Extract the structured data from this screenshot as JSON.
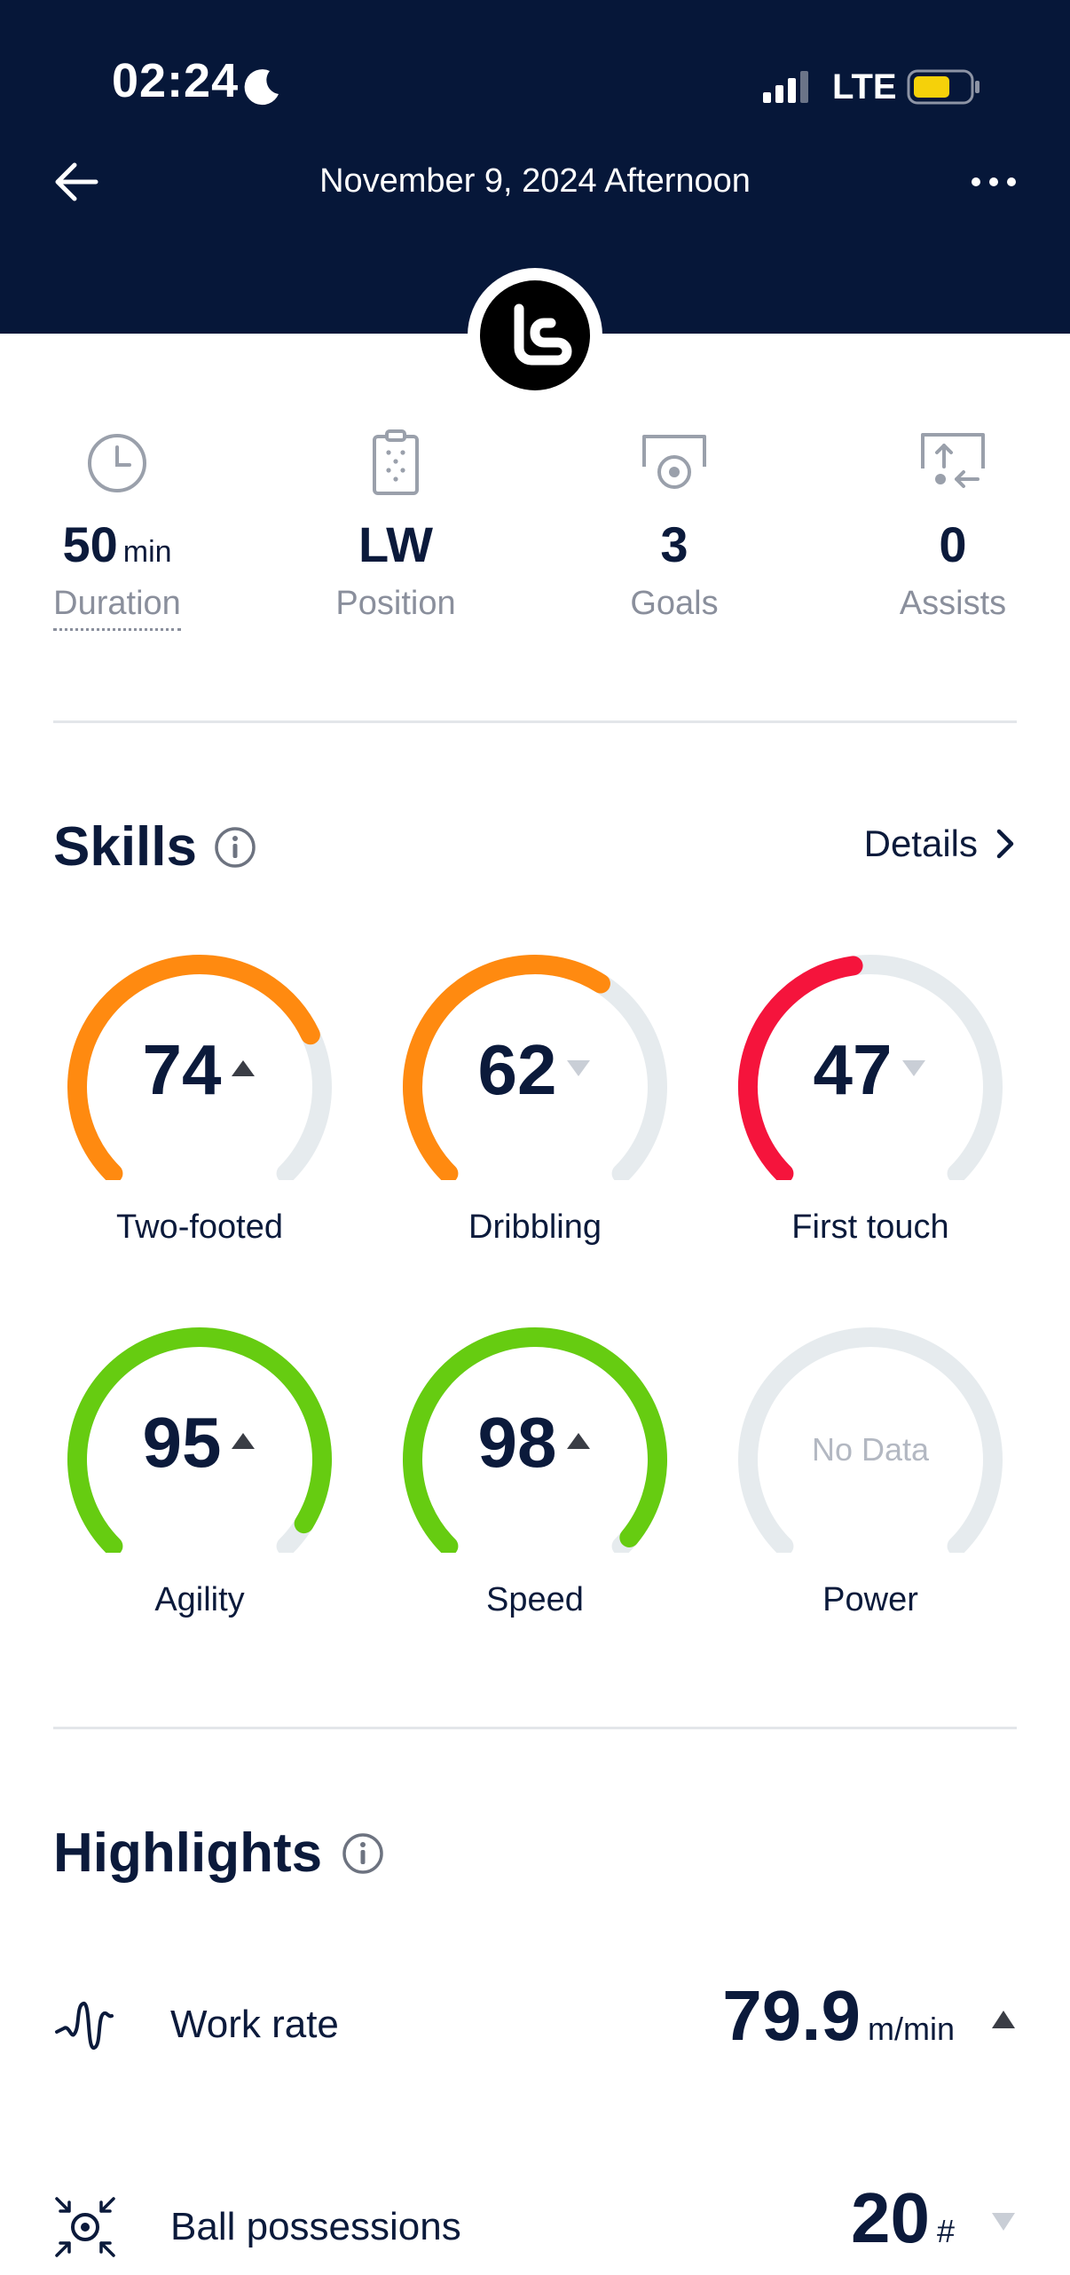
{
  "status_bar": {
    "time": "02:24",
    "network": "LTE"
  },
  "header": {
    "title": "November 9, 2024 Afternoon"
  },
  "stats": [
    {
      "value": "50",
      "unit": "min",
      "label": "Duration",
      "icon": "clock-icon"
    },
    {
      "value": "LW",
      "unit": "",
      "label": "Position",
      "icon": "clipboard-icon"
    },
    {
      "value": "3",
      "unit": "",
      "label": "Goals",
      "icon": "goal-icon"
    },
    {
      "value": "0",
      "unit": "",
      "label": "Assists",
      "icon": "assist-icon"
    }
  ],
  "skills": {
    "title": "Skills",
    "details_label": "Details",
    "items": [
      {
        "label": "Two-footed",
        "score": "74",
        "value": 74,
        "trend": "up",
        "color": "#ff8a10"
      },
      {
        "label": "Dribbling",
        "score": "62",
        "value": 62,
        "trend": "down",
        "color": "#ff8a10"
      },
      {
        "label": "First touch",
        "score": "47",
        "value": 47,
        "trend": "down",
        "color": "#f5143c"
      },
      {
        "label": "Agility",
        "score": "95",
        "value": 95,
        "trend": "up",
        "color": "#66cc11"
      },
      {
        "label": "Speed",
        "score": "98",
        "value": 98,
        "trend": "up",
        "color": "#66cc11"
      },
      {
        "label": "Power",
        "score": "No Data",
        "value": null,
        "trend": "none",
        "color": "#e6ebee"
      }
    ]
  },
  "highlights": {
    "title": "Highlights",
    "items": [
      {
        "label": "Work rate",
        "value": "79.9",
        "unit": "m/min",
        "trend": "up",
        "icon": "work-rate-icon"
      },
      {
        "label": "Ball possessions",
        "value": "20",
        "unit": "#",
        "trend": "down",
        "icon": "ball-possession-icon"
      }
    ]
  },
  "colors": {
    "header_bg": "#061739",
    "text": "#0b1a3b",
    "muted": "#8a8f9c",
    "track": "#e6ebee",
    "trend_up": "#3a3d45",
    "trend_down": "#c9ced6"
  }
}
